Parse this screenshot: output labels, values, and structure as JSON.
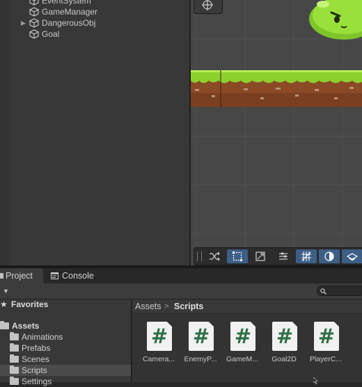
{
  "hierarchy": {
    "items": [
      {
        "label": "EventSystem",
        "icon": "gameobject-cube-icon",
        "expandable": false
      },
      {
        "label": "GameManager",
        "icon": "gameobject-cube-icon",
        "expandable": false
      },
      {
        "label": "DangerousObj",
        "icon": "gameobject-cube-icon",
        "expandable": true
      },
      {
        "label": "Goal",
        "icon": "gameobject-cube-icon",
        "expandable": false
      }
    ]
  },
  "scene": {
    "toolbar_tools": [
      "toggle-icon",
      "rect-tool-icon",
      "snap-icon",
      "layers-icon",
      "grid-icon",
      "shading-icon",
      "visibility-icon"
    ],
    "active_color": "#3d5f86"
  },
  "tabs": {
    "project": "Project",
    "console": "Console"
  },
  "project": {
    "tree": {
      "favorites": "Favorites",
      "assets": "Assets",
      "folders": [
        "Animations",
        "Prefabs",
        "Scenes",
        "Scripts",
        "Settings"
      ],
      "selected": "Scripts"
    },
    "breadcrumb": {
      "root": "Assets",
      "separator": ">",
      "current": "Scripts"
    },
    "files": [
      {
        "name": "Camera...",
        "icon": "csharp-script-icon"
      },
      {
        "name": "EnemyP...",
        "icon": "csharp-script-icon"
      },
      {
        "name": "GameM...",
        "icon": "csharp-script-icon"
      },
      {
        "name": "Goal2D",
        "icon": "csharp-script-icon"
      },
      {
        "name": "PlayerC...",
        "icon": "csharp-script-icon"
      }
    ],
    "script_icon_glyph": "#"
  },
  "colors": {
    "panel_bg": "#383838",
    "selection": "#4b4b4b",
    "script_green": "#2e6e45",
    "slime_green": "#8ed42e"
  }
}
